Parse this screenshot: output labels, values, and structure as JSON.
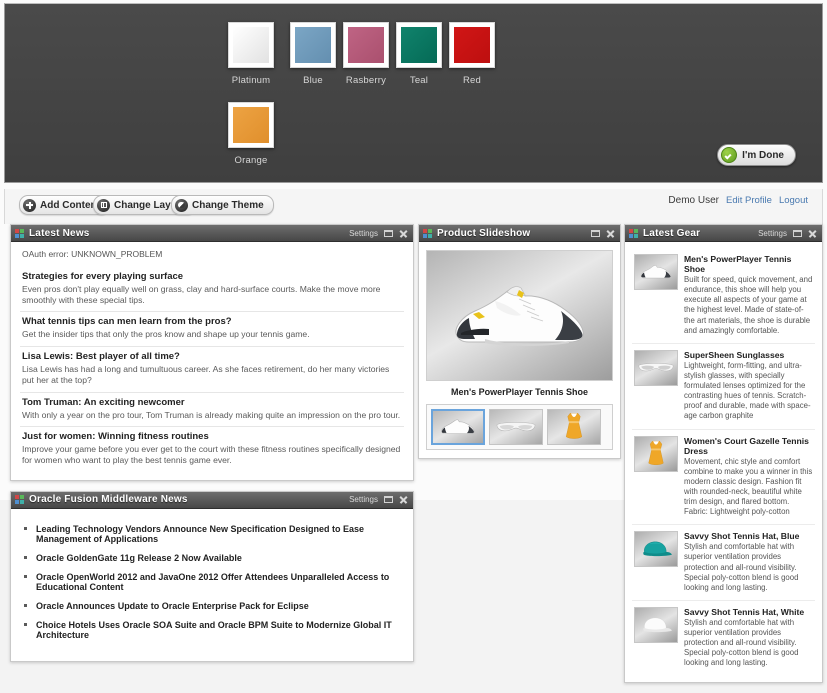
{
  "theme_picker": {
    "swatches": [
      {
        "label": "Platinum",
        "color": "#f2f2f2",
        "selected": true
      },
      {
        "label": "Blue",
        "color": "#6f9cbd",
        "selected": false
      },
      {
        "label": "Rasberry",
        "color": "#b55a79",
        "selected": false
      },
      {
        "label": "Teal",
        "color": "#0d7a66",
        "selected": false
      },
      {
        "label": "Red",
        "color": "#ca1414",
        "selected": false
      },
      {
        "label": "Orange",
        "color": "#e89a37",
        "selected": false
      }
    ],
    "done_label": "I'm Done",
    "done_icon": "green-check-icon"
  },
  "toolbar": {
    "buttons": [
      {
        "label": "Add Content",
        "icon": "plus-circle-icon"
      },
      {
        "label": "Change Layout",
        "icon": "layout-icon"
      },
      {
        "label": "Change Theme",
        "icon": "theme-circle-icon"
      }
    ],
    "user_name": "Demo User",
    "edit_profile": "Edit Profile",
    "logout": "Logout"
  },
  "panels": {
    "latest_news": {
      "title": "Latest News",
      "settings_label": "Settings",
      "error": "OAuth error: UNKNOWN_PROBLEM",
      "items": [
        {
          "title": "Strategies for every playing surface",
          "desc": "Even pros don't play equally well on grass, clay and hard-surface courts. Make the move more smoothly with these special tips."
        },
        {
          "title": "What tennis tips can men learn from the pros?",
          "desc": "Get the insider tips that only the pros know and shape up your tennis game."
        },
        {
          "title": "Lisa Lewis: Best player of all time?",
          "desc": "Lisa Lewis has had a long and tumultuous career. As she faces retirement, do her many victories put her at the top?"
        },
        {
          "title": "Tom Truman: An exciting newcomer",
          "desc": "With only a year on the pro tour, Tom Truman is already making quite an impression on the pro tour."
        },
        {
          "title": "Just for women: Winning fitness routines",
          "desc": "Improve your game before you ever get to the court with these fitness routines specifically designed for women who want to play the best tennis game ever."
        }
      ]
    },
    "oracle_news": {
      "title": "Oracle Fusion Middleware News",
      "settings_label": "Settings",
      "items": [
        "Leading Technology Vendors Announce New Specification Designed to Ease Management of Applications",
        "Oracle GoldenGate 11g Release 2 Now Available",
        "Oracle OpenWorld 2012 and JavaOne 2012 Offer Attendees Unparalleled Access to Educational Content",
        "Oracle Announces Update to Oracle Enterprise Pack for Eclipse",
        "Choice Hotels Uses Oracle SOA Suite and Oracle BPM Suite to Modernize Global IT Architecture"
      ]
    },
    "product_slideshow": {
      "title": "Product Slideshow",
      "caption": "Men's PowerPlayer Tennis Shoe",
      "thumbs": [
        {
          "name": "tennis-shoe-thumb",
          "selected": true
        },
        {
          "name": "sunglasses-thumb",
          "selected": false
        },
        {
          "name": "tennis-dress-thumb",
          "selected": false
        }
      ]
    },
    "latest_gear": {
      "title": "Latest Gear",
      "settings_label": "Settings",
      "items": [
        {
          "name": "Men's PowerPlayer Tennis Shoe",
          "desc": "Built for speed, quick movement, and endurance, this shoe will help you execute all aspects of your game at the highest level. Made of state-of-the art materials, the shoe is durable and amazingly comfortable.",
          "image": "white-tennis-shoe"
        },
        {
          "name": "SuperSheen Sunglasses",
          "desc": "Lightweight, form-fitting, and ultra-stylish glasses, with specially formulated lenses optimized for the contrasting hues of tennis. Scratch-proof and durable, made with space-age carbon graphite",
          "image": "white-sunglasses"
        },
        {
          "name": "Women's Court Gazelle Tennis Dress",
          "desc": "Movement, chic style and comfort combine to make you a winner in this modern classic design. Fashion fit with rounded-neck, beautiful white trim design, and flared bottom. Fabric: Lightweight poly-cotton",
          "image": "yellow-dress"
        },
        {
          "name": "Savvy Shot Tennis Hat, Blue",
          "desc": "Stylish and comfortable hat with superior ventilation provides protection and all-round visibility. Special poly-cotton blend is good looking and long lasting.",
          "image": "teal-hat"
        },
        {
          "name": "Savvy Shot Tennis Hat, White",
          "desc": "Stylish and comfortable hat with superior ventilation provides protection and all-round visibility. Special poly-cotton blend is good looking and long lasting.",
          "image": "white-hat"
        }
      ]
    }
  }
}
